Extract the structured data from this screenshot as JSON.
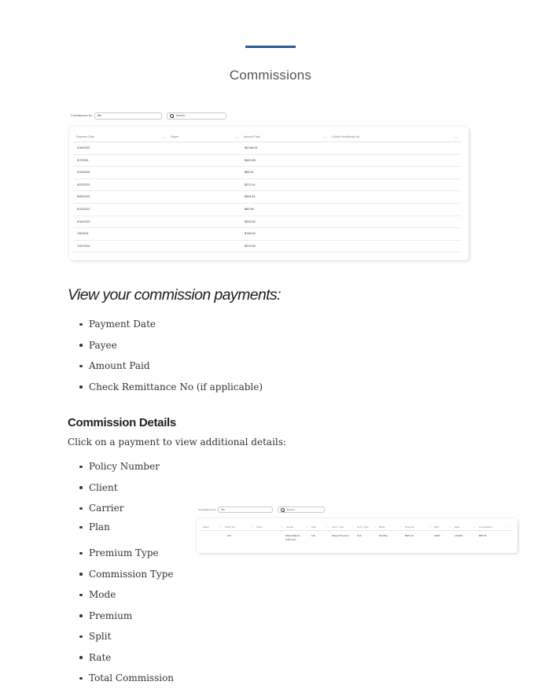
{
  "page": {
    "title": "Commissions",
    "accent_color": "#2c5a92"
  },
  "screenshot1": {
    "filter_label": "Commissions for:",
    "filter_value": "Me",
    "search_placeholder": "Search...",
    "search_icon": "search-icon",
    "columns": [
      "Payment Date",
      "Payee",
      "Amount Paid",
      "Check Remittance No."
    ],
    "rows": [
      {
        "date": "4/16/2021",
        "payee": "",
        "amount": "$4,048.31",
        "check": ""
      },
      {
        "date": "5/7/2021",
        "payee": "",
        "amount": "$409.83",
        "check": ""
      },
      {
        "date": "5/13/2021",
        "payee": "",
        "amount": "$56.30",
        "check": ""
      },
      {
        "date": "5/24/2021",
        "payee": "",
        "amount": "$370.41",
        "check": ""
      },
      {
        "date": "5/28/2021",
        "payee": "",
        "amount": "$394.61",
        "check": ""
      },
      {
        "date": "6/11/2021",
        "payee": "",
        "amount": "$60.58",
        "check": ""
      },
      {
        "date": "6/16/2021",
        "payee": "",
        "amount": "$333.60",
        "check": ""
      },
      {
        "date": "7/6/2021",
        "payee": "",
        "amount": "$768.52",
        "check": ""
      },
      {
        "date": "7/22/2021",
        "payee": "",
        "amount": "$370.69",
        "check": ""
      }
    ]
  },
  "section1": {
    "heading": "View your commission payments:",
    "items": [
      "Payment Date",
      "Payee",
      "Amount Paid",
      "Check Remittance No (if applicable)"
    ]
  },
  "section2": {
    "heading": "Commission Details",
    "intro": "Click on a payment to view additional details:",
    "items": [
      "Policy Number",
      "Client",
      "Carrier",
      "Plan",
      "Premium Type",
      "Commission Type",
      "Mode",
      "Premium",
      "Split",
      "Rate",
      "Total Commission"
    ]
  },
  "screenshot2": {
    "filter_label": "Commissions for:",
    "filter_value": "Wh",
    "search_placeholder": "Search...",
    "columns": [
      "Agent",
      "Policy No.",
      "Client",
      "Carrier",
      "Plan",
      "Prem. Type",
      "Com. Type",
      "Mode",
      "Premium",
      "Split",
      "Rate",
      "Commission"
    ],
    "row": {
      "agent": "",
      "policy_no": "227",
      "client": "",
      "carrier_line1": "Mass Mutual -",
      "carrier_line2": "SUP (LG)",
      "plan": "Life",
      "prem_type": "Target Premium",
      "com_type": "Ovk",
      "mode": "Monthly",
      "premium": "$401.41",
      "split": "100%",
      "rate": "13.00%",
      "commission": "$56.36"
    }
  }
}
